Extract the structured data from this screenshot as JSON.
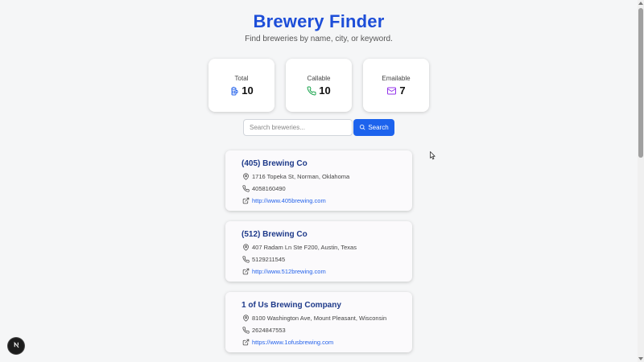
{
  "header": {
    "title": "Brewery Finder",
    "subtitle": "Find breweries by name, city, or keyword."
  },
  "stats": [
    {
      "label": "Total",
      "value": "10",
      "icon": "beer-mug-icon",
      "color": "#2563eb"
    },
    {
      "label": "Callable",
      "value": "10",
      "icon": "phone-icon",
      "color": "#16a34a"
    },
    {
      "label": "Emailable",
      "value": "7",
      "icon": "mail-icon",
      "color": "#9333ea"
    }
  ],
  "search": {
    "placeholder": "Search breweries...",
    "value": "",
    "button_label": "Search"
  },
  "breweries": [
    {
      "name": "(405) Brewing Co",
      "address": "1716 Topeka St, Norman, Oklahoma",
      "phone": "4058160490",
      "website": "http://www.405brewing.com"
    },
    {
      "name": "(512) Brewing Co",
      "address": "407 Radam Ln Ste F200, Austin, Texas",
      "phone": "5129211545",
      "website": "http://www.512brewing.com"
    },
    {
      "name": "1 of Us Brewing Company",
      "address": "8100 Washington Ave, Mount Pleasant, Wisconsin",
      "phone": "2624847553",
      "website": "https://www.1ofusbrewing.com"
    }
  ],
  "colors": {
    "accent": "#1d63ed",
    "title": "#1d4ed8",
    "card_title": "#1e3a8a",
    "link": "#2563eb"
  }
}
